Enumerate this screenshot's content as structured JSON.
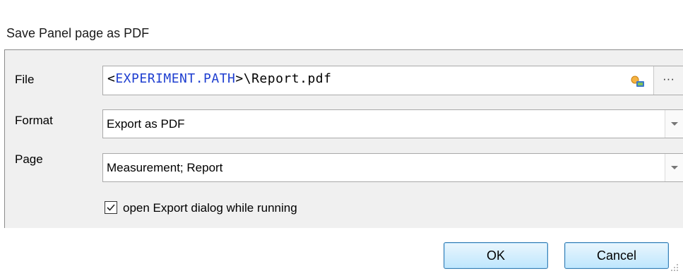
{
  "dialog": {
    "title": "Save Panel page as PDF"
  },
  "form": {
    "file_label": "File",
    "file_value_prefix": "<",
    "file_value_var": "EXPERIMENT.PATH",
    "file_value_suffix": ">\\Report.pdf",
    "browse_label": "···",
    "format_label": "Format",
    "format_value": "Export as PDF",
    "page_label": "Page",
    "page_value": "Measurement; Report",
    "checkbox_label": "open Export dialog while running",
    "checkbox_checked": true
  },
  "footer": {
    "ok_label": "OK",
    "cancel_label": "Cancel"
  },
  "colors": {
    "variable_text": "#1f3fd0",
    "content_bg": "#f0f0f0",
    "button_border": "#3c7fb1"
  },
  "icons": {
    "file_action": "insert-variable-icon",
    "browse": "ellipsis-icon",
    "dropdown": "chevron-down-icon",
    "check": "checkmark-icon",
    "resize": "resize-grip-icon"
  }
}
